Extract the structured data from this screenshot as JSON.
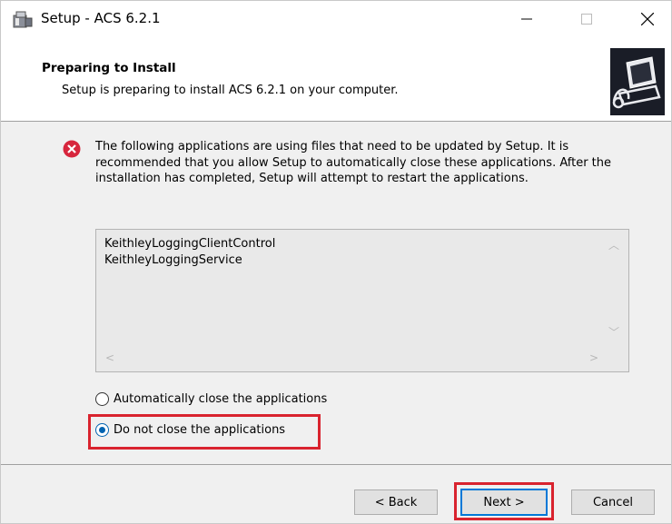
{
  "window": {
    "title": "Setup - ACS 6.2.1",
    "controls": {
      "minimize": "—",
      "maximize": "☐",
      "close": "✕"
    }
  },
  "header": {
    "title": "Preparing to Install",
    "subtitle": "Setup is preparing to install ACS 6.2.1 on your computer."
  },
  "message": "The following applications are using files that need to be updated by Setup. It is recommended that you allow Setup to automatically close these applications. After the installation has completed, Setup will attempt to restart the applications.",
  "applications": [
    "KeithleyLoggingClientControl",
    "KeithleyLoggingService"
  ],
  "options": {
    "auto_close": {
      "label": "Automatically close the applications",
      "selected": false
    },
    "do_not_close": {
      "label": "Do not close the applications",
      "selected": true
    }
  },
  "buttons": {
    "back": "< Back",
    "next": "Next >",
    "cancel": "Cancel"
  },
  "icons": {
    "app": "installer-icon",
    "error": "error-icon",
    "logo": "computer-logo-icon"
  },
  "colors": {
    "highlight": "#d9232e",
    "error": "#d7263d",
    "accent": "#0078d7"
  }
}
